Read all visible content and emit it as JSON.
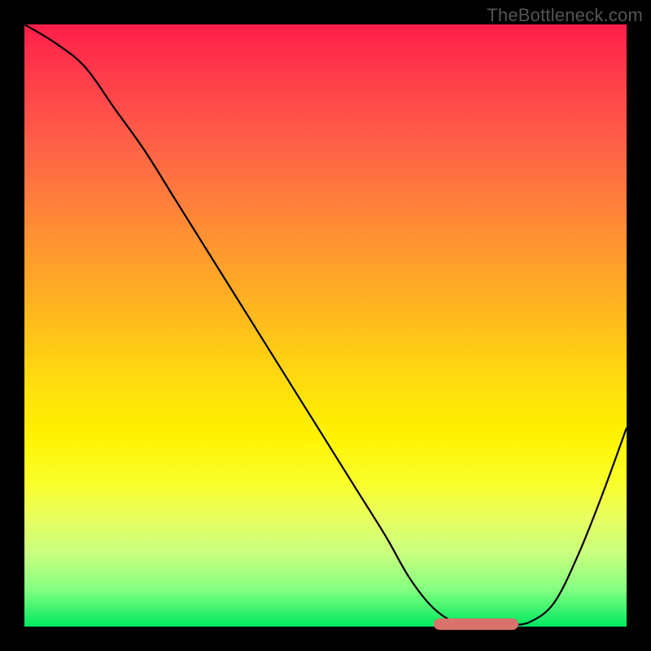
{
  "watermark": "TheBottleneck.com",
  "chart_data": {
    "type": "line",
    "title": "",
    "xlabel": "",
    "ylabel": "",
    "xlim": [
      0,
      100
    ],
    "ylim": [
      0,
      100
    ],
    "x": [
      0,
      5,
      10,
      15,
      20,
      25,
      30,
      35,
      40,
      45,
      50,
      55,
      60,
      64,
      68,
      72,
      76,
      80,
      84,
      88,
      92,
      96,
      100
    ],
    "values": [
      100,
      97,
      93,
      86,
      79,
      71,
      63,
      55,
      47,
      39,
      31,
      23,
      15,
      8,
      3,
      0.5,
      0.2,
      0.2,
      0.8,
      4,
      12,
      22,
      33
    ],
    "highlight_range_x": [
      68,
      82
    ],
    "background_gradient": [
      {
        "stop": 0,
        "color": "#ff1e4a"
      },
      {
        "stop": 50,
        "color": "#ffd000"
      },
      {
        "stop": 100,
        "color": "#00e860"
      }
    ],
    "highlight_color": "#d9726b"
  }
}
